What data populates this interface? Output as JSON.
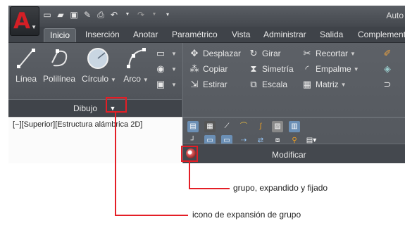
{
  "window": {
    "title": "Auto"
  },
  "tabs": [
    {
      "label": "Inicio",
      "active": true
    },
    {
      "label": "Inserción",
      "active": false
    },
    {
      "label": "Anotar",
      "active": false
    },
    {
      "label": "Paramétrico",
      "active": false
    },
    {
      "label": "Vista",
      "active": false
    },
    {
      "label": "Administrar",
      "active": false
    },
    {
      "label": "Salida",
      "active": false
    },
    {
      "label": "Complement",
      "active": false
    }
  ],
  "draw_panel": {
    "title": "Dibujo",
    "tools": [
      {
        "label": "Línea",
        "icon": "line-icon"
      },
      {
        "label": "Polilínea",
        "icon": "polyline-icon"
      },
      {
        "label": "Círculo",
        "icon": "circle-icon"
      },
      {
        "label": "Arco",
        "icon": "arc-icon"
      }
    ]
  },
  "modify_panel": {
    "title": "Modificar",
    "col1": [
      "Desplazar",
      "Copiar",
      "Estirar"
    ],
    "col2": [
      "Girar",
      "Simetría",
      "Escala"
    ],
    "col3": [
      "Recortar",
      "Empalme",
      "Matriz"
    ]
  },
  "viewport": {
    "label": "[−][Superior][Estructura alámbrica 2D]"
  },
  "callouts": {
    "pinned": "grupo, expandido y fijado",
    "expander": "icono de expansión de grupo"
  },
  "colors": {
    "accent": "#e41e26",
    "ribbon": "#53575d"
  }
}
